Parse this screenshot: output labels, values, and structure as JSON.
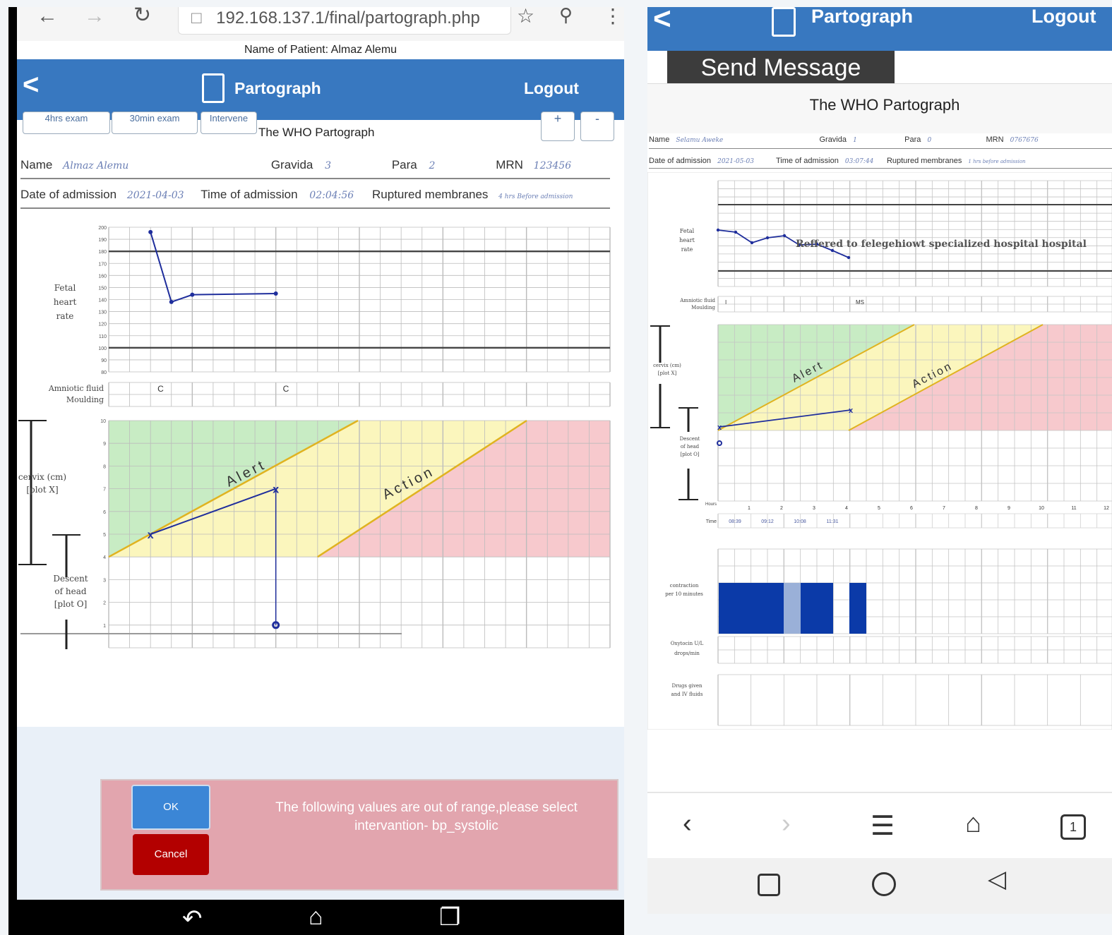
{
  "left": {
    "url": "192.168.137.1/final/partograph.php",
    "patient_line": "Name of Patient: Almaz Alemu",
    "app_title": "Partograph",
    "logout": "Logout",
    "back": "<",
    "tabs": [
      "4hrs exam",
      "30min exam",
      "Intervene"
    ],
    "zoom_in": "+",
    "zoom_out": "-",
    "chart_title": "The WHO Partograph",
    "name_label": "Name",
    "name_value": "Almaz Alemu",
    "gravida_label": "Gravida",
    "gravida_value": "3",
    "para_label": "Para",
    "para_value": "2",
    "mrn_label": "MRN",
    "mrn_value": "123456",
    "doa_label": "Date of admission",
    "doa_value": "2021-04-03",
    "toa_label": "Time of admission",
    "toa_value": "02:04:56",
    "rm_label": "Ruptured membranes",
    "rm_value": "4 hrs Before admission",
    "fhr_label": [
      "Fetal",
      "heart",
      "rate"
    ],
    "fhr_ticks": [
      "200",
      "190",
      "180",
      "170",
      "160",
      "150",
      "140",
      "130",
      "120",
      "110",
      "100",
      "90",
      "80"
    ],
    "amniotic_label": [
      "Amniotic fluid",
      "Moulding"
    ],
    "amniotic_marks": [
      "C",
      "C"
    ],
    "cervix_label": [
      "cervix (cm)",
      "[plot X]"
    ],
    "descent_label": [
      "Descent",
      "of head",
      "[plot O]"
    ],
    "cervix_ticks": [
      "10",
      "9",
      "8",
      "7",
      "6",
      "5",
      "4",
      "3",
      "2",
      "1"
    ],
    "alert": "Alert",
    "action": "Action",
    "dialog_ok": "OK",
    "dialog_cancel": "Cancel",
    "dialog_message": "The following values are out of range,please select intervantion- bp_systolic",
    "colors": {
      "blue": "#3878c0",
      "dialog": "#e2a5ae",
      "cancel": "#b30000",
      "ok": "#3b86d6"
    }
  },
  "right": {
    "app_title": "Partograph",
    "logout": "Logout",
    "back": "<",
    "send_message": "Send Message",
    "chart_title": "The WHO Partograph",
    "name_label": "Name",
    "name_value": "Selamu Aweke",
    "gravida_label": "Gravida",
    "gravida_value": "1",
    "para_label": "Para",
    "para_value": "0",
    "mrn_label": "MRN",
    "mrn_value": "0767676",
    "doa_label": "Date of admission",
    "doa_value": "2021-05-03",
    "toa_label": "Time of admission",
    "toa_value": "03:07:44",
    "rm_label": "Ruptured membranes",
    "rm_value": "1 hrs before admission",
    "fhr_label": [
      "Fetal",
      "heart",
      "rate"
    ],
    "amniotic_label": [
      "Amniotic fluid",
      "Moulding"
    ],
    "amniotic_marks": [
      "I",
      "MS"
    ],
    "referral": "Reffered to felegehiowt specialized hospital hospital",
    "cervix_label": [
      "cervix (cm)",
      "[plot X]"
    ],
    "descent_label": [
      "Descent",
      "of head",
      "[plot O]"
    ],
    "alert": "Alert",
    "action": "Action",
    "hours_label": "Hours",
    "hours": [
      "1",
      "2",
      "3",
      "4",
      "5",
      "6",
      "7",
      "8",
      "9",
      "10",
      "11",
      "12"
    ],
    "time_label": "Time",
    "times": [
      "08:39",
      "09:12",
      "10:08",
      "11:31"
    ],
    "contraction_label": [
      "contraction",
      "per 10 minutes"
    ],
    "oxytocin_label": [
      "Oxytocin U/L",
      "drops/min"
    ],
    "drugs_label": [
      "Drugs given",
      "and IV fluids"
    ],
    "tab_count": "1"
  },
  "chart_data": [
    {
      "type": "line",
      "title": "The WHO Partograph — Fetal heart rate (left)",
      "ylabel": "Fetal heart rate",
      "ylim": [
        80,
        200
      ],
      "x": [
        1,
        1.5,
        2,
        4
      ],
      "series": [
        {
          "values": [
            196,
            138,
            144,
            145
          ]
        }
      ]
    },
    {
      "type": "line",
      "title": "The WHO Partograph — Cervix (left)",
      "ylabel": "cervix (cm)",
      "ylim": [
        0,
        10
      ],
      "x": [
        1,
        4
      ],
      "series": [
        {
          "values": [
            5,
            7
          ]
        }
      ]
    }
  ]
}
